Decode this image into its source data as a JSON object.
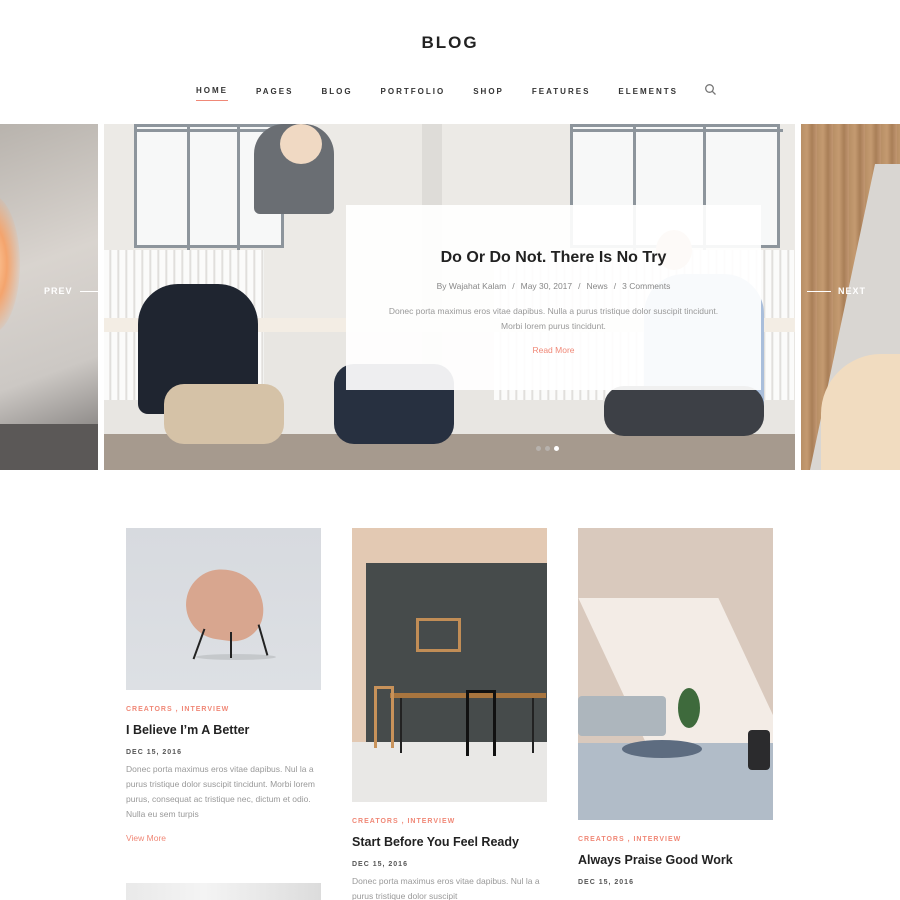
{
  "site": {
    "logo": "BLOG"
  },
  "nav": {
    "items": [
      "HOME",
      "PAGES",
      "BLOG",
      "PORTFOLIO",
      "SHOP",
      "FEATURES",
      "ELEMENTS"
    ],
    "active_index": 0,
    "search_icon": "search-icon"
  },
  "slider": {
    "prev_label": "PREV",
    "next_label": "NEXT",
    "slide_count": 3,
    "active_slide": 2,
    "card": {
      "title": "Do Or Do Not. There Is No Try",
      "author": "By Wajahat Kalam",
      "date": "May 30, 2017",
      "category": "News",
      "comments": "3 Comments",
      "separator": "/",
      "excerpt": "Donec porta maximus eros vitae dapibus. Nulla a purus tristique dolor suscipit tincidunt. Morbi lorem purus tincidunt.",
      "read_more": "Read More"
    }
  },
  "posts": [
    {
      "categories": [
        "CREATORS",
        "INTERVIEW"
      ],
      "title": "I Believe I’m A Better",
      "date": "DEC 15, 2016",
      "excerpt": "Donec porta maximus eros vitae dapibus. Nul la a purus tristique dolor suscipit tincidunt. Morbi lorem purus, consequat ac tristique nec, dictum et odio. Nulla eu sem turpis",
      "more": "View More"
    },
    {
      "categories": [
        "CREATORS",
        "INTERVIEW"
      ],
      "title": "Start Before You Feel Ready",
      "date": "DEC 15, 2016",
      "excerpt": "Donec porta maximus eros vitae dapibus. Nul la a purus tristique dolor suscipit"
    },
    {
      "categories": [
        "CREATORS",
        "INTERVIEW"
      ],
      "title": "Always Praise Good Work",
      "date": "DEC 15, 2016"
    }
  ],
  "colors": {
    "accent": "#f08877",
    "text": "#222222",
    "muted": "#999999"
  }
}
